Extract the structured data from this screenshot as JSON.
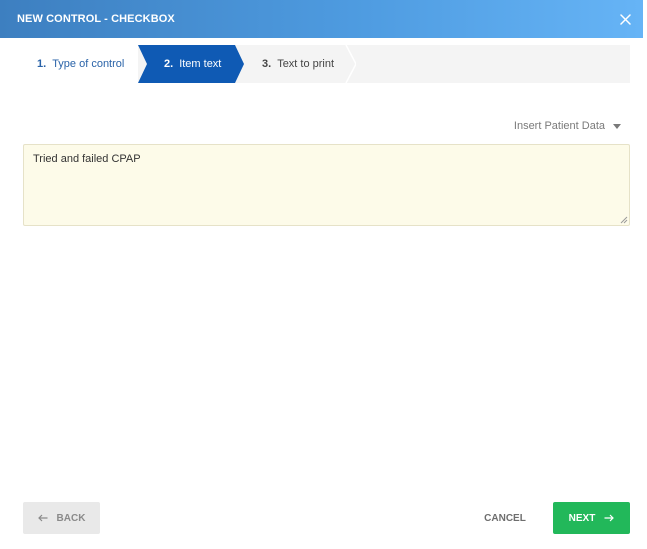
{
  "dialog": {
    "title": "NEW CONTROL - CHECKBOX",
    "close_icon": "close-icon"
  },
  "stepper": {
    "steps": [
      {
        "number": "1.",
        "label": "Type of control",
        "state": "completed"
      },
      {
        "number": "2.",
        "label": "Item text",
        "state": "active"
      },
      {
        "number": "3.",
        "label": "Text to print",
        "state": "upcoming"
      }
    ]
  },
  "insert_patient_data": {
    "label": "Insert Patient Data",
    "icon": "caret-down-icon"
  },
  "item_text": {
    "value": "Tried and failed CPAP"
  },
  "footer": {
    "back_label": "BACK",
    "back_icon": "arrow-left-icon",
    "cancel_label": "CANCEL",
    "next_label": "NEXT",
    "next_icon": "arrow-right-icon"
  },
  "colors": {
    "header_start": "#3d7fc0",
    "header_end": "#66b4f6",
    "step_active": "#0f5ab4",
    "step_completed_text": "#2a63a8",
    "text_area_bg": "#fdfbe9",
    "next_button": "#22b85a",
    "back_button": "#e9e9e9"
  }
}
